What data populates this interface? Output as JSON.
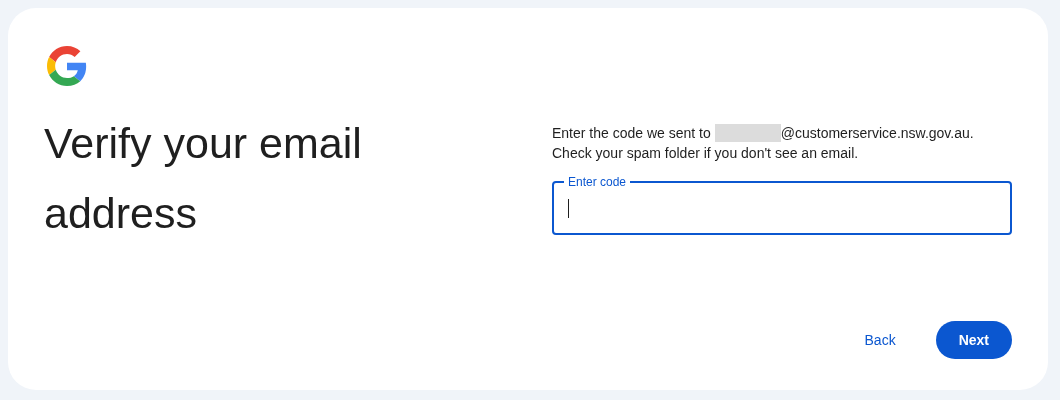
{
  "title": "Verify your email address",
  "instruction": {
    "before": "Enter the code we sent to",
    "redacted": true,
    "after": "@customerservice.nsw.gov.au."
  },
  "hint": "Check your spam folder if you don't see an email.",
  "code_field": {
    "label": "Enter code",
    "focused": true
  },
  "buttons": [
    {
      "label": "Back",
      "kind": "text"
    },
    {
      "label": "Next",
      "kind": "filled"
    }
  ]
}
